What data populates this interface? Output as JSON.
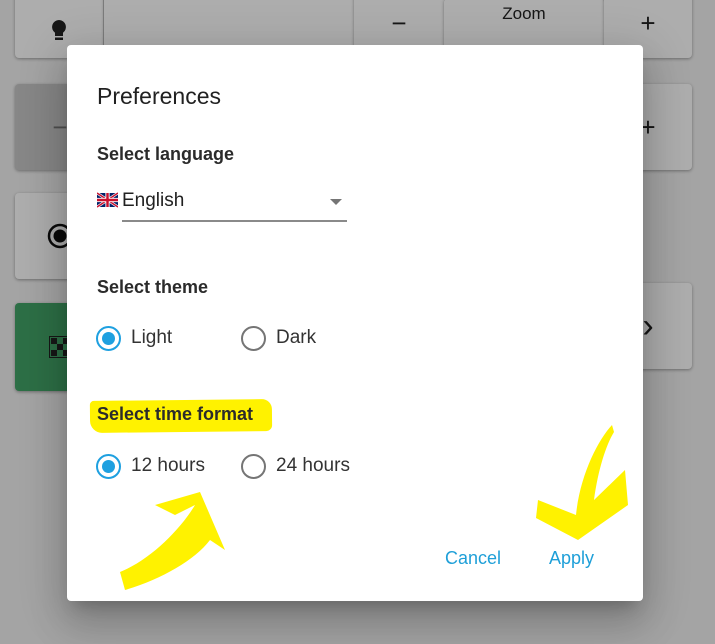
{
  "background": {
    "zoom_label": "Zoom",
    "minus_symbol": "−",
    "plus_symbol": "+",
    "chevron_symbol": "›"
  },
  "dialog": {
    "title": "Preferences",
    "language": {
      "label": "Select language",
      "selected": "English",
      "flag_icon": "uk-flag-icon"
    },
    "theme": {
      "label": "Select theme",
      "options": [
        "Light",
        "Dark"
      ],
      "selected": "Light"
    },
    "time_format": {
      "label": "Select time format",
      "options": [
        "12 hours",
        "24 hours"
      ],
      "selected": "12 hours"
    },
    "actions": {
      "cancel_label": "Cancel",
      "apply_label": "Apply"
    }
  },
  "colors": {
    "accent": "#1ea0e0",
    "highlight": "#fff200"
  }
}
